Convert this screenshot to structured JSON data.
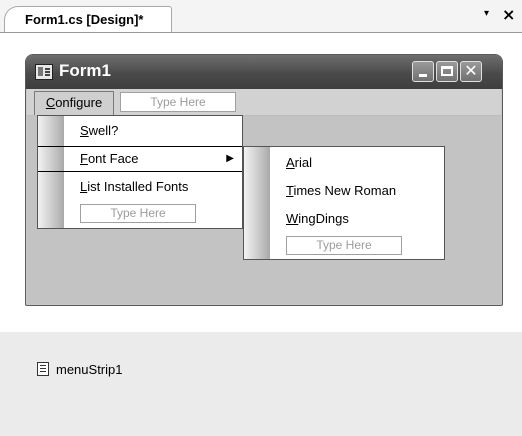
{
  "document_tab": {
    "title": "Form1.cs [Design]*",
    "menu_glyph": "▾",
    "close_glyph": "×"
  },
  "form": {
    "title": "Form1",
    "menu_bar": {
      "items": [
        {
          "label": "Configure",
          "mnemonic": "C",
          "rest": "onfigure"
        }
      ],
      "type_here": "Type Here"
    }
  },
  "configure_menu": {
    "items": [
      {
        "mnemonic": "S",
        "rest": "well?"
      },
      {
        "mnemonic": "F",
        "rest": "ont Face",
        "selected": true,
        "has_submenu": true
      },
      {
        "mnemonic": "L",
        "rest": "ist Installed Fonts"
      }
    ],
    "type_here": "Type Here"
  },
  "font_face_menu": {
    "items": [
      {
        "mnemonic": "A",
        "rest": "rial"
      },
      {
        "mnemonic": "T",
        "rest": "imes New Roman"
      },
      {
        "mnemonic": "W",
        "rest": "ingDings"
      }
    ],
    "type_here": "Type Here"
  },
  "component_tray": {
    "items": [
      {
        "label": "menuStrip1",
        "icon": "menustrip-icon"
      }
    ]
  }
}
